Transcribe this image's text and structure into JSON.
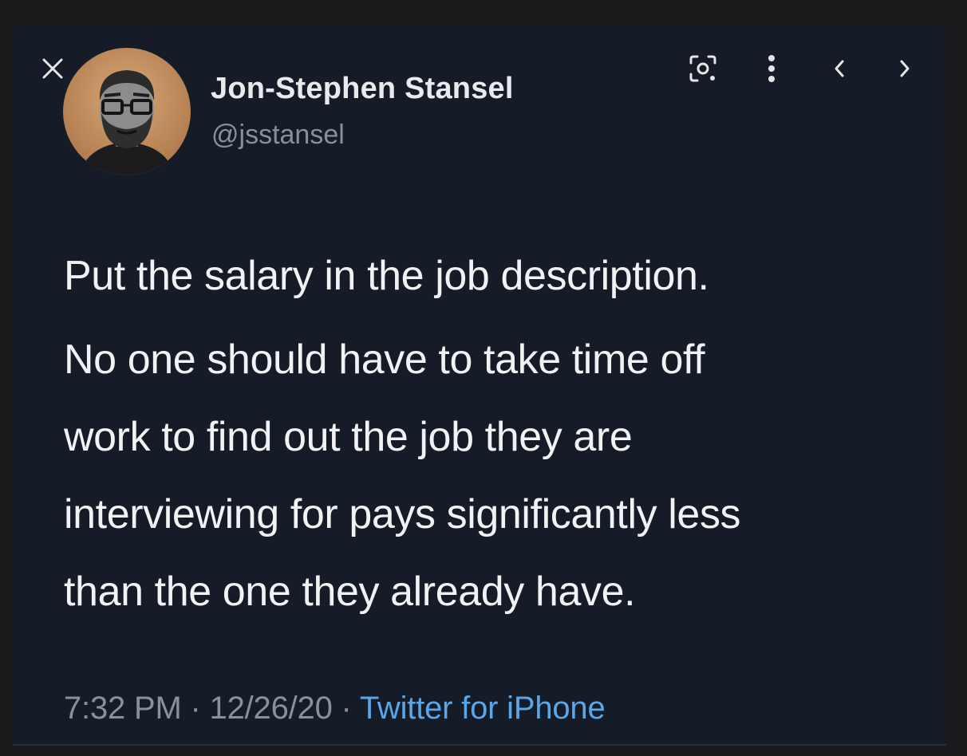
{
  "viewer": {
    "close_icon": "close-icon",
    "toolbar": {
      "icons": [
        "lens-search-icon",
        "more-vertical-icon",
        "chevron-left-icon",
        "chevron-right-icon"
      ]
    }
  },
  "tweet": {
    "author": {
      "display_name": "Jon-Stephen Stansel",
      "handle": "@jsstansel"
    },
    "text_lines": {
      "para1": "Put the salary in the job description.",
      "para2_line1": "No one should have to take time off",
      "para2_line2": "work to find out the job they are",
      "para2_line3": "interviewing for pays significantly less",
      "para2_line4": "than the one they already have."
    },
    "meta": {
      "time": "7:32 PM",
      "separator": " · ",
      "date": "12/26/20",
      "separator2": " · ",
      "source": "Twitter for iPhone"
    }
  },
  "colors": {
    "background": "#151b27",
    "text": "#f1f2f3",
    "muted": "#8a9099",
    "link": "#5aa6e6"
  }
}
